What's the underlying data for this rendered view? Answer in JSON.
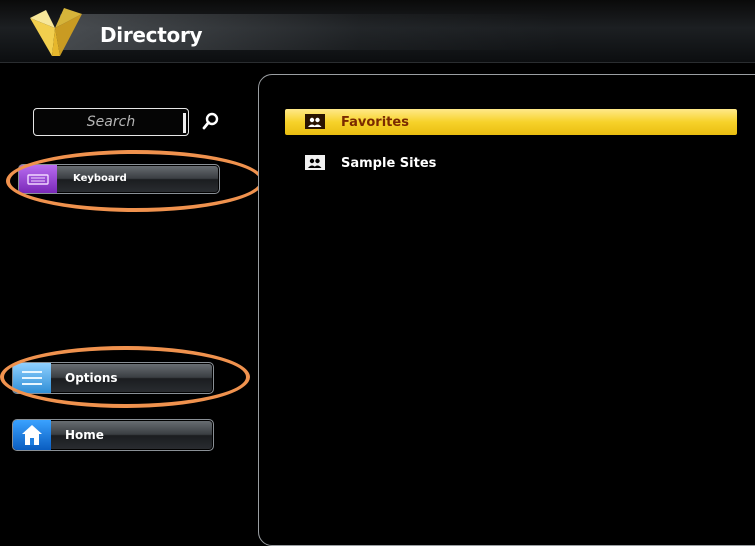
{
  "header": {
    "title": "Directory"
  },
  "search": {
    "placeholder": "Search"
  },
  "nav": {
    "keyboard_label": "Keyboard",
    "options_label": "Options",
    "home_label": "Home"
  },
  "list": {
    "items": [
      {
        "label": "Favorites",
        "icon": "folder-people-icon",
        "selected": true
      },
      {
        "label": "Sample Sites",
        "icon": "folder-people-icon",
        "selected": false
      }
    ]
  },
  "colors": {
    "selection": "#f7d22a",
    "annotation_ring": "#f0924e",
    "keyboard_accent": "#9b4ad8",
    "options_accent": "#5ab3f0",
    "home_accent": "#1f7fe0"
  }
}
